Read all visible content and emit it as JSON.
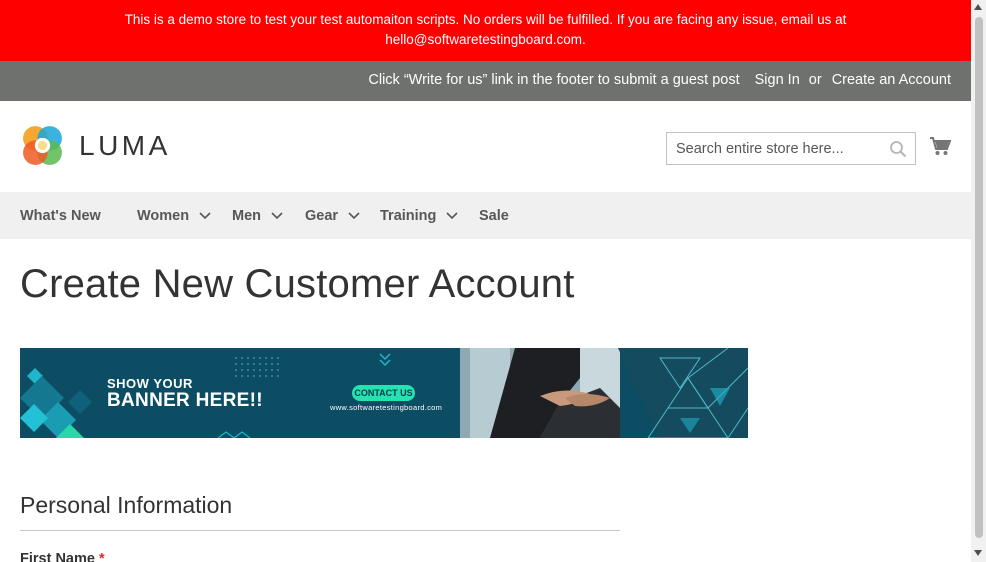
{
  "demo_notice": {
    "line1": "This is a demo store to test your test automaiton scripts. No orders will be fulfilled. If you are facing any issue, email us at",
    "line2": "hello@softwaretestingboard.com."
  },
  "panel": {
    "guest_post": "Click “Write for us” link in the footer to submit a guest post",
    "sign_in": "Sign In",
    "or": "or",
    "create_account": "Create an Account"
  },
  "header": {
    "logo_text": "LUMA",
    "search_placeholder": "Search entire store here...",
    "search_icon": "magnifier-icon",
    "cart_icon": "cart-icon"
  },
  "nav": {
    "items": [
      {
        "label": "What's New",
        "has_submenu": false
      },
      {
        "label": "Women",
        "has_submenu": true
      },
      {
        "label": "Men",
        "has_submenu": true
      },
      {
        "label": "Gear",
        "has_submenu": true
      },
      {
        "label": "Training",
        "has_submenu": true
      },
      {
        "label": "Sale",
        "has_submenu": false
      }
    ]
  },
  "page": {
    "title": "Create New Customer Account"
  },
  "ad_banner": {
    "line1": "SHOW YOUR",
    "line2": "BANNER HERE!!",
    "cta": "CONTACT US",
    "url": "www.softwaretestingboard.com"
  },
  "form": {
    "section_title": "Personal Information",
    "first_name_label": "First Name",
    "required_mark": "*"
  },
  "colors": {
    "demo_bar": "#ff0000",
    "panel_bar": "#6e716e",
    "nav_bar": "#f0f0f0",
    "banner_bg": "#0d4d63",
    "cta": "#25e3b0",
    "required": "#e02b27"
  }
}
